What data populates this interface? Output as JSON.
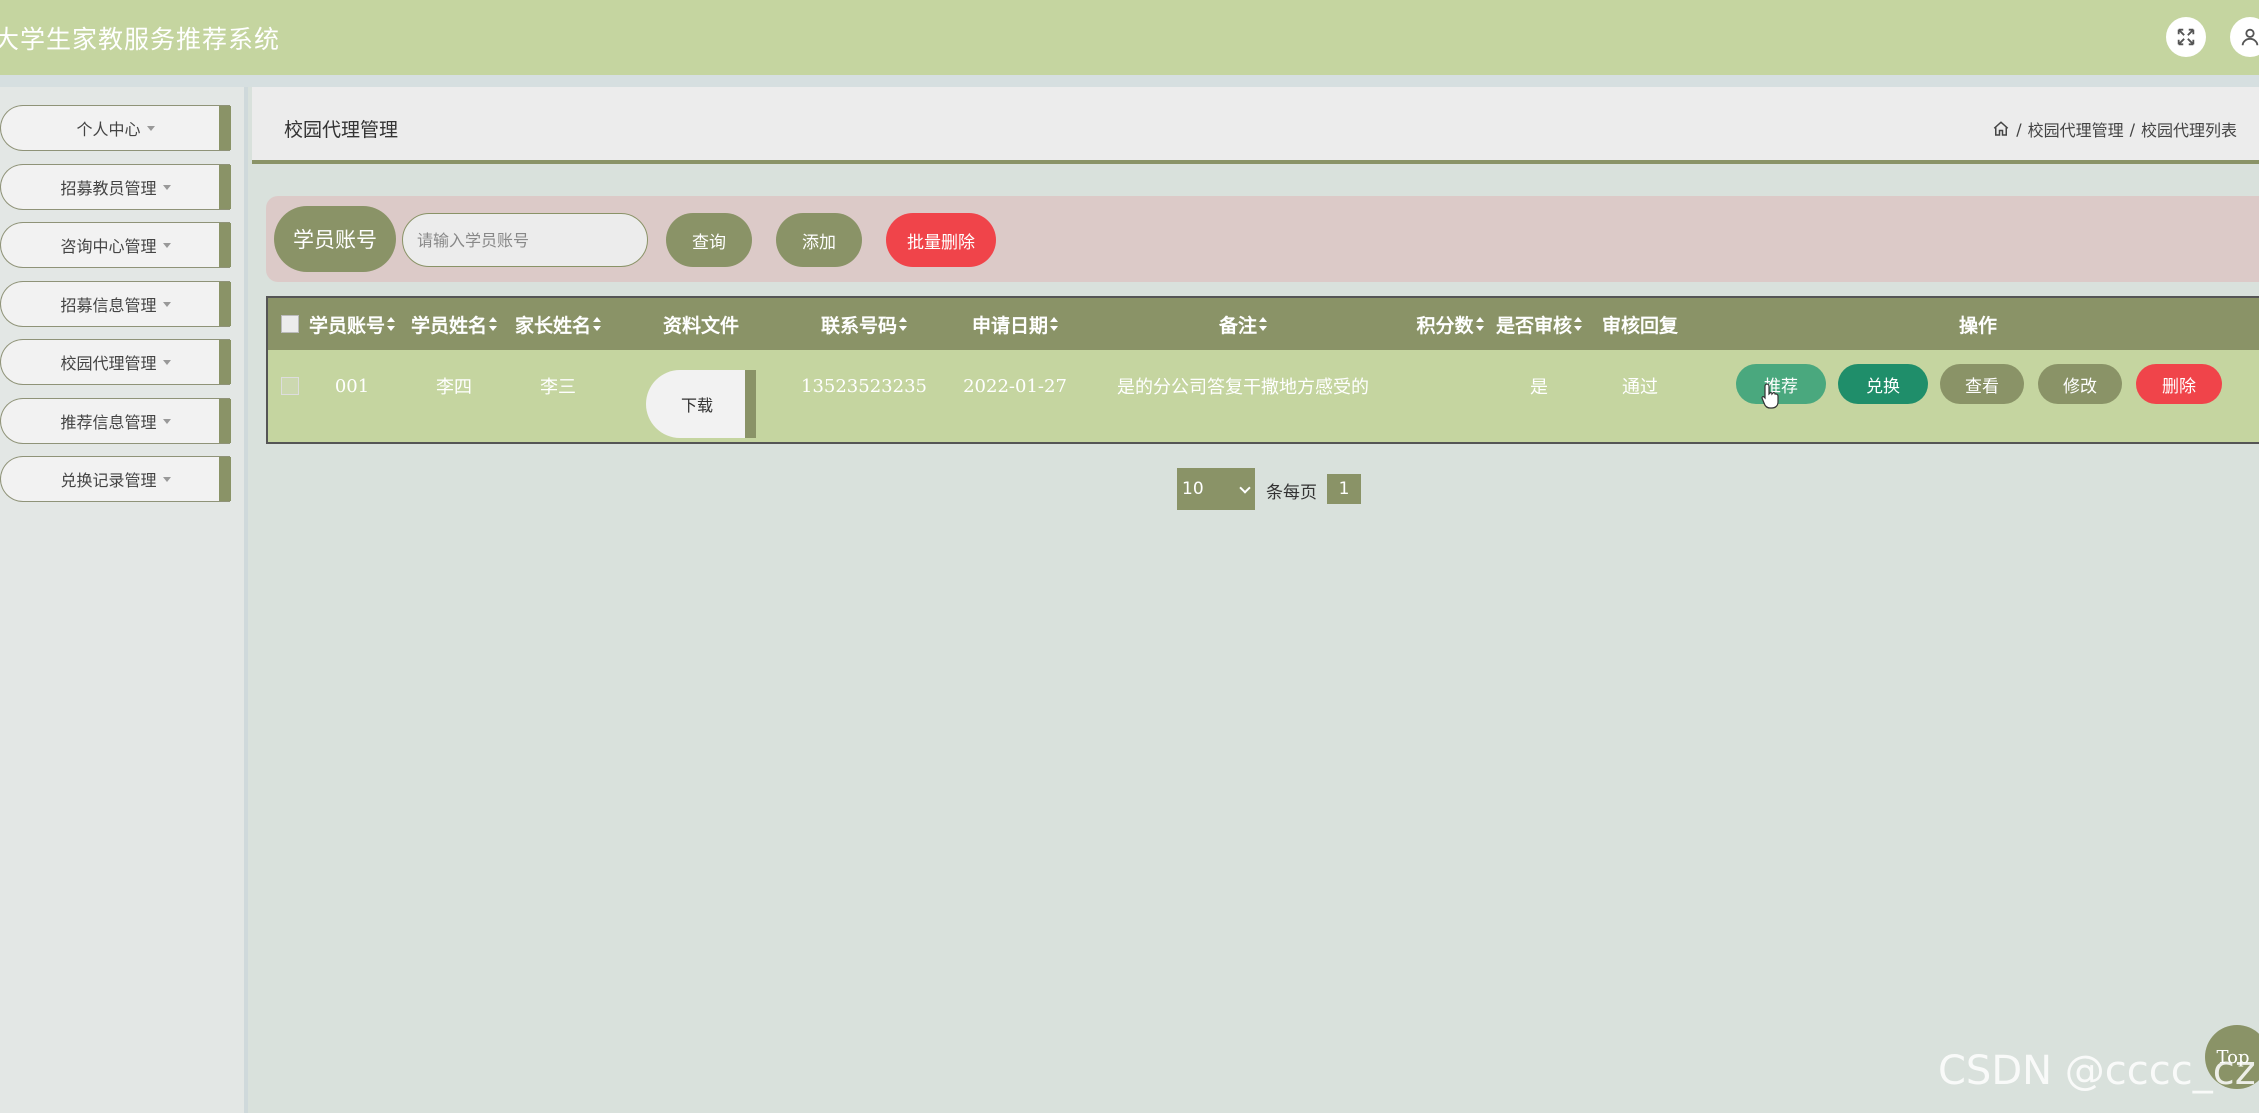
{
  "header": {
    "title": "大学生家教服务推荐系统"
  },
  "sidebar": {
    "items": [
      {
        "label": "个人中心"
      },
      {
        "label": "招募教员管理"
      },
      {
        "label": "咨询中心管理"
      },
      {
        "label": "招募信息管理"
      },
      {
        "label": "校园代理管理"
      },
      {
        "label": "推荐信息管理"
      },
      {
        "label": "兑换记录管理"
      }
    ]
  },
  "page": {
    "title": "校园代理管理",
    "breadcrumb": [
      "校园代理管理",
      "校园代理列表"
    ],
    "breadcrumb_sep": "/"
  },
  "search": {
    "label": "学员账号",
    "placeholder": "请输入学员账号",
    "query_label": "查询",
    "add_label": "添加",
    "batch_delete_label": "批量删除"
  },
  "table": {
    "columns": [
      "学员账号",
      "学员姓名",
      "家长姓名",
      "资料文件",
      "联系号码",
      "申请日期",
      "备注",
      "积分数",
      "是否审核",
      "审核回复",
      "操作"
    ],
    "rows": [
      {
        "account": "001",
        "name": "李四",
        "parent": "李三",
        "file_button": "下载",
        "phone": "13523523235",
        "date": "2022-01-27",
        "note": "是的分公司答复干撒地方感受的",
        "points": "",
        "reviewed": "是",
        "reply": "通过",
        "actions": {
          "recommend": "推荐",
          "exchange": "兑换",
          "view": "查看",
          "edit": "修改",
          "delete": "删除"
        }
      }
    ]
  },
  "pagination": {
    "page_size": "10",
    "per_page_label": "条每页",
    "current_page": "1"
  },
  "top_button": "Top",
  "watermark": "CSDN @cccc_cz",
  "colors": {
    "header": "#c5d5a0",
    "olive": "#8a9367",
    "red": "#f0444a",
    "teal": "#2a9a74",
    "search_bg": "#dccac8"
  }
}
